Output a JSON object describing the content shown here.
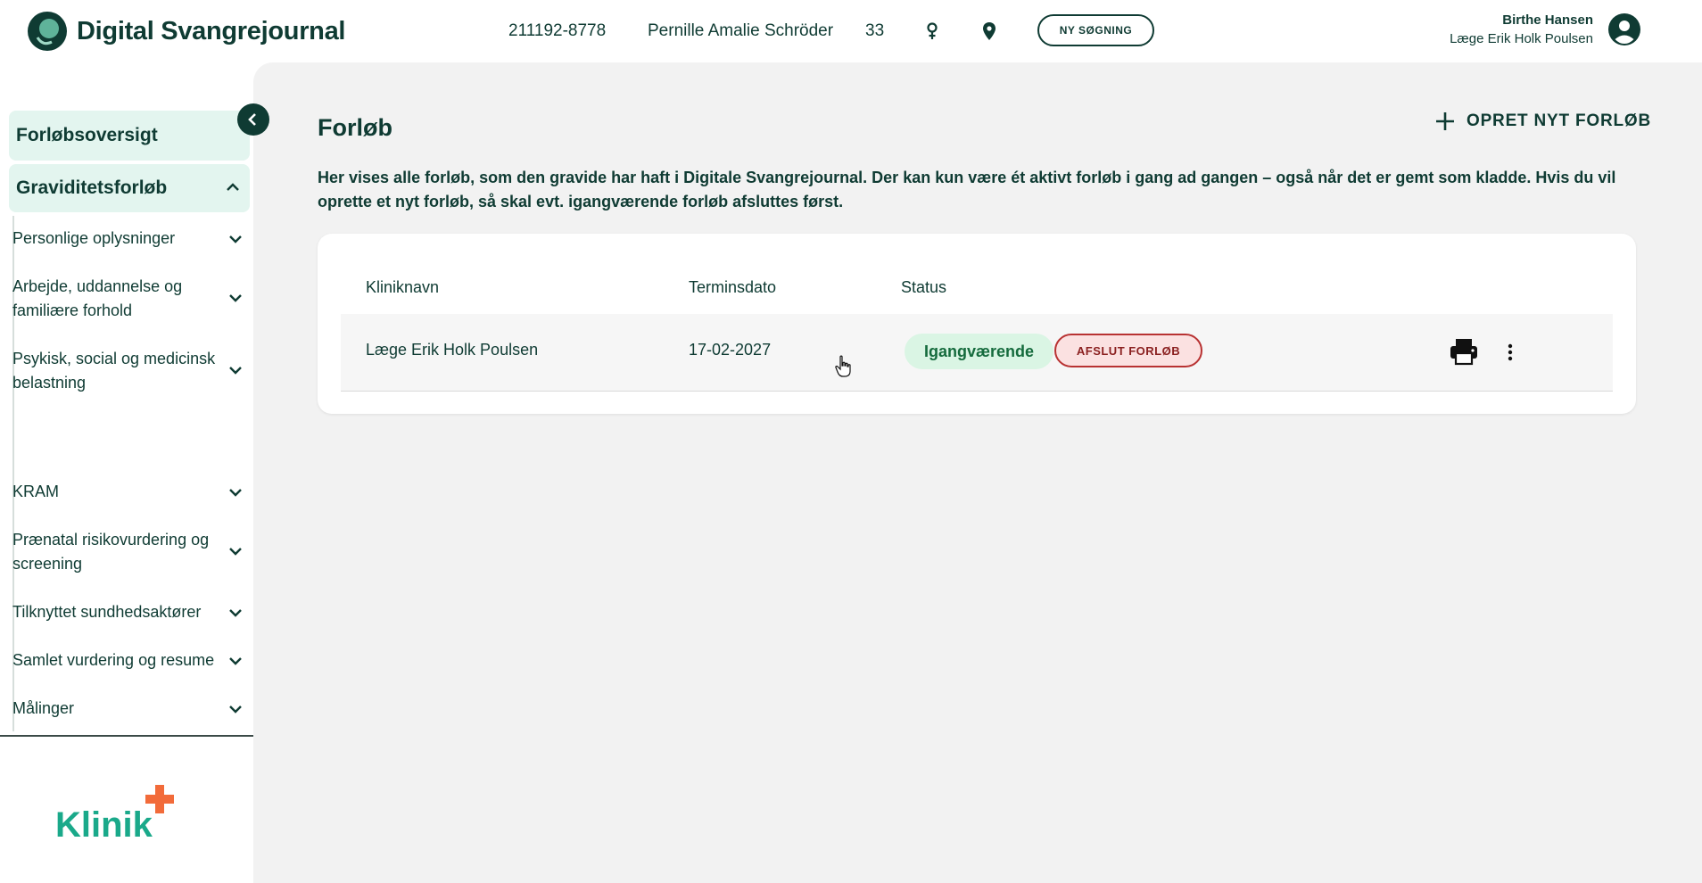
{
  "header": {
    "app_title": "Digital Svangrejournal",
    "patient_cpr": "211192-8778",
    "patient_name": "Pernille Amalie Schröder",
    "patient_age": "33",
    "new_search_label": "NY SØGNING",
    "user_name": "Birthe Hansen",
    "user_role": "Læge Erik Holk Poulsen"
  },
  "sidebar": {
    "overview_label": "Forløbsoversigt",
    "group_label": "Graviditetsforløb",
    "items": [
      {
        "label": "Personlige oplysninger"
      },
      {
        "label": "Arbejde, uddannelse og familiære forhold"
      },
      {
        "label": "Psykisk, social og medicinsk belastning"
      },
      {
        "label": "KRAM"
      },
      {
        "label": "Prænatal risikovurdering og screening"
      },
      {
        "label": "Tilknyttet sundhedsaktører"
      },
      {
        "label": "Samlet vurdering og resume"
      },
      {
        "label": "Målinger"
      }
    ],
    "footer_logo_text": "Klinik"
  },
  "main": {
    "title": "Forløb",
    "create_label": "OPRET NYT FORLØB",
    "intro_text": "Her vises alle forløb, som den gravide har haft i Digitale Svangrejournal. Der kan kun være ét aktivt forløb i gang ad gangen – også når det er gemt som kladde. Hvis du vil oprette et nyt forløb, så skal evt. igangværende forløb afsluttes først.",
    "table": {
      "columns": [
        "Kliniknavn",
        "Terminsdato",
        "Status"
      ],
      "rows": [
        {
          "clinic": "Læge Erik Holk Poulsen",
          "due_date": "17-02-2027",
          "status": "Igangværende",
          "end_label": "AFSLUT FORLØB"
        }
      ]
    }
  },
  "colors": {
    "primary": "#0f3b33",
    "sidebar_active_bg": "#e3f5ef",
    "status_bg": "#daf5e4",
    "status_text": "#156b3d",
    "danger_border": "#b83232",
    "danger_bg": "#fbe1e1",
    "klinik_teal": "#1aa98a",
    "klinik_cross": "#f26b3a"
  },
  "icons": [
    "app-logo-icon",
    "female-icon",
    "location-pin-icon",
    "user-avatar-icon",
    "chevron-left-icon",
    "chevron-up-icon",
    "chevron-down-icon",
    "plus-icon",
    "print-icon",
    "more-vertical-icon",
    "hand-cursor-icon"
  ]
}
